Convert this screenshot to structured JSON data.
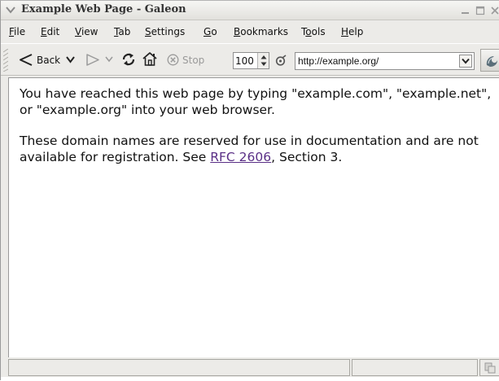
{
  "window": {
    "title": "Example Web Page - Galeon"
  },
  "menubar": {
    "items": [
      {
        "mnemonic": "F",
        "rest": "ile"
      },
      {
        "mnemonic": "E",
        "rest": "dit"
      },
      {
        "mnemonic": "V",
        "rest": "iew"
      },
      {
        "mnemonic": "T",
        "rest": "ab"
      },
      {
        "mnemonic": "S",
        "rest": "ettings"
      },
      {
        "mnemonic": "G",
        "rest": "o"
      },
      {
        "mnemonic": "B",
        "rest": "ookmarks"
      },
      {
        "pre": "T",
        "mnemonic": "o",
        "rest": "ols"
      },
      {
        "mnemonic": "H",
        "rest": "elp"
      }
    ]
  },
  "toolbar": {
    "back_label": "Back",
    "stop_label": "Stop",
    "zoom_value": "100",
    "url_value": "http://example.org/"
  },
  "page": {
    "paragraph1": "You have reached this web page by typing \"example.com\", \"example.net\", or \"example.org\" into your web browser.",
    "paragraph2_before": "These domain names are reserved for use in documentation and are not available for registration. See ",
    "link_text": "RFC 2606",
    "paragraph2_after": ", Section 3."
  },
  "statusbar": {
    "message": ""
  },
  "colors": {
    "link": "#5a2f86",
    "chrome": "#ecebe8"
  },
  "icons": [
    "window-menu-icon",
    "minimize-icon",
    "maximize-icon",
    "close-icon",
    "back-arrow-icon",
    "forward-arrow-icon",
    "reload-icon",
    "home-icon",
    "stop-icon",
    "zoom-icon",
    "url-dropdown-icon",
    "galeon-throbber-icon",
    "resize-grip-icon"
  ]
}
